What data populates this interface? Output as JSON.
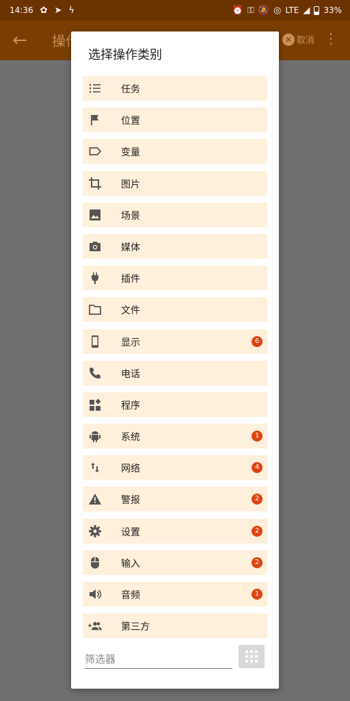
{
  "status_bar": {
    "time": "14:36",
    "network": "LTE",
    "battery": "33%"
  },
  "appbar": {
    "title": "操作",
    "cancel_label": "取消"
  },
  "dialog": {
    "title": "选择操作类别",
    "items": [
      {
        "label": "任务",
        "icon": "list-numbered-icon",
        "badge": ""
      },
      {
        "label": "位置",
        "icon": "flag-icon",
        "badge": ""
      },
      {
        "label": "变量",
        "icon": "label-icon",
        "badge": ""
      },
      {
        "label": "图片",
        "icon": "crop-icon",
        "badge": ""
      },
      {
        "label": "场景",
        "icon": "image-icon",
        "badge": ""
      },
      {
        "label": "媒体",
        "icon": "camera-icon",
        "badge": ""
      },
      {
        "label": "插件",
        "icon": "plug-icon",
        "badge": ""
      },
      {
        "label": "文件",
        "icon": "folder-icon",
        "badge": ""
      },
      {
        "label": "显示",
        "icon": "phone-device-icon",
        "badge": "6"
      },
      {
        "label": "电话",
        "icon": "phone-call-icon",
        "badge": ""
      },
      {
        "label": "程序",
        "icon": "widgets-icon",
        "badge": ""
      },
      {
        "label": "系统",
        "icon": "android-icon",
        "badge": "1"
      },
      {
        "label": "网络",
        "icon": "swap-vert-icon",
        "badge": "4"
      },
      {
        "label": "警报",
        "icon": "warning-icon",
        "badge": "2"
      },
      {
        "label": "设置",
        "icon": "gear-icon",
        "badge": "2"
      },
      {
        "label": "输入",
        "icon": "mouse-icon",
        "badge": "2"
      },
      {
        "label": "音频",
        "icon": "speaker-icon",
        "badge": "1"
      },
      {
        "label": "第三方",
        "icon": "group-add-icon",
        "badge": ""
      }
    ],
    "filter_placeholder": "筛选器"
  }
}
